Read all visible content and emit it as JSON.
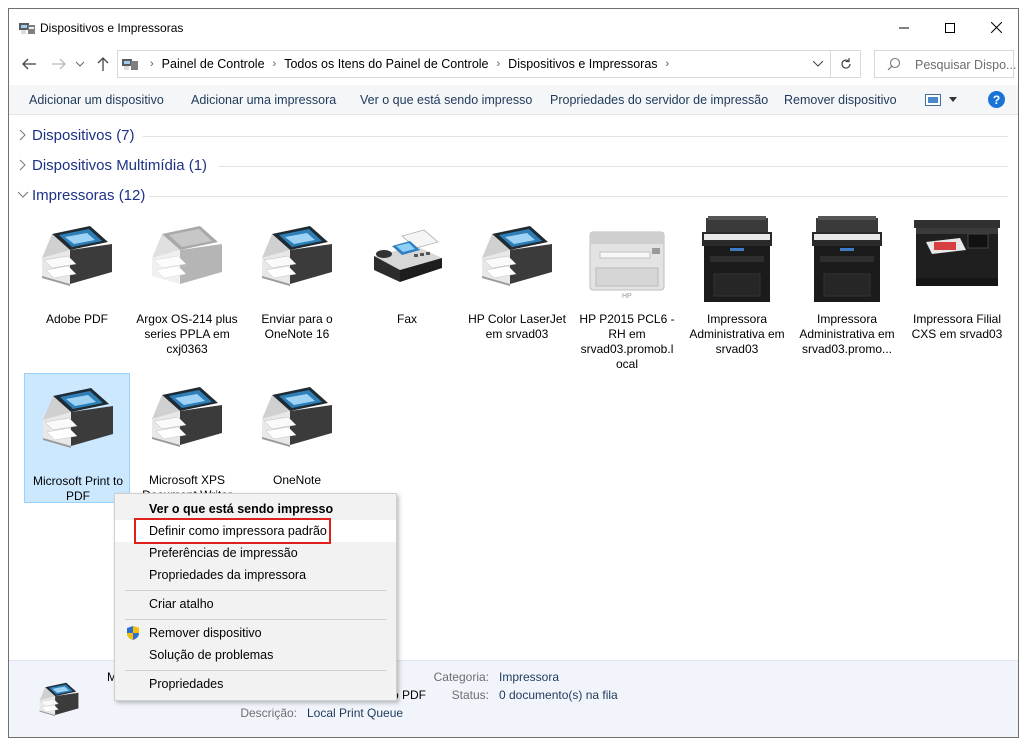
{
  "window": {
    "title": "Dispositivos e Impressoras"
  },
  "address": {
    "crumbs": [
      "Painel de Controle",
      "Todos os Itens do Painel de Controle",
      "Dispositivos e Impressoras"
    ],
    "search_placeholder": "Pesquisar Dispo..."
  },
  "toolbar": {
    "add_device": "Adicionar um dispositivo",
    "add_printer": "Adicionar uma impressora",
    "see_printing": "Ver o que está sendo impresso",
    "server_props": "Propriedades do servidor de impressão",
    "remove_device": "Remover dispositivo",
    "help": "?"
  },
  "groups": {
    "devices": "Dispositivos (7)",
    "multimedia": "Dispositivos Multimídia (1)",
    "printers": "Impressoras (12)"
  },
  "printers": [
    {
      "label": "Adobe PDF",
      "kind": "generic-printer-icon"
    },
    {
      "label": "Argox OS-214 plus series PPLA em cxj0363",
      "kind": "generic-printer-icon"
    },
    {
      "label": "Enviar para o OneNote 16",
      "kind": "generic-printer-icon"
    },
    {
      "label": "Fax",
      "kind": "fax-icon"
    },
    {
      "label": "HP Color LaserJet em srvad03",
      "kind": "generic-printer-icon"
    },
    {
      "label": "HP P2015 PCL6 -RH em srvad03.promob.l ocal",
      "kind": "laser-printer-icon"
    },
    {
      "label": "Impressora Administrativa em srvad03",
      "kind": "mfp-printer-icon"
    },
    {
      "label": "Impressora Administrativa em srvad03.promo...",
      "kind": "mfp-printer-icon"
    },
    {
      "label": "Impressora Filial CXS em srvad03",
      "kind": "color-mfp-icon"
    },
    {
      "label": "Microsoft Print to PDF",
      "kind": "generic-printer-icon"
    },
    {
      "label": "Microsoft XPS Document Writer",
      "kind": "generic-printer-icon"
    },
    {
      "label": "OneNote",
      "kind": "generic-printer-icon"
    }
  ],
  "details": {
    "name_fragment": "M",
    "model_fragment": "o PDF",
    "category_label": "Categoria:",
    "category_value": "Impressora",
    "status_label": "Status:",
    "status_value": "0 documento(s) na fila",
    "description_label": "Descrição:",
    "description_value": "Local Print Queue"
  },
  "context_menu": {
    "see_printing": "Ver o que está sendo impresso",
    "set_default": "Definir como impressora padrão",
    "preferences": "Preferências de impressão",
    "printer_props": "Propriedades da impressora",
    "create_shortcut": "Criar atalho",
    "remove_device": "Remover dispositivo",
    "troubleshoot": "Solução de problemas",
    "properties": "Propriedades"
  },
  "colors": {
    "highlight_box": "#e0201b",
    "selection": "#cce8ff",
    "link": "#1e3287"
  }
}
